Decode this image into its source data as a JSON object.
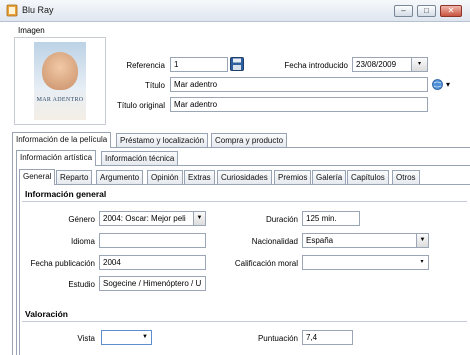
{
  "window": {
    "title": "Blu Ray",
    "minimize": "–",
    "maximize": "□",
    "close": "✕",
    "app_icon": "film-icon"
  },
  "image_section": {
    "label": "Imagen",
    "poster_title": "MAR ADENTRO"
  },
  "header_fields": {
    "referencia_label": "Referencia",
    "referencia_value": "1",
    "fecha_label": "Fecha introducido",
    "fecha_value": "23/08/2009",
    "titulo_label": "Título",
    "titulo_value": "Mar adentro",
    "titulo_original_label": "Título original",
    "titulo_original_value": "Mar adentro"
  },
  "main_tabs": [
    "Información de la película",
    "Préstamo y localización",
    "Compra y producto"
  ],
  "sub_tabs": [
    "Información artística",
    "Información técnica"
  ],
  "detail_tabs": [
    "General",
    "Reparto",
    "Argumento",
    "Opinión",
    "Extras",
    "Curiosidades",
    "Premios",
    "Galería",
    "Capítulos",
    "Otros"
  ],
  "general": {
    "section_title": "Información general",
    "genero_label": "Género",
    "genero_value": "2004: Oscar: Mejor peli",
    "duracion_label": "Duración",
    "duracion_value": "125 min.",
    "idioma_label": "Idioma",
    "idioma_value": "",
    "nacionalidad_label": "Nacionalidad",
    "nacionalidad_value": "España",
    "fecha_publicacion_label": "Fecha publicación",
    "fecha_publicacion_value": "2004",
    "calificacion_label": "Calificación moral",
    "calificacion_value": "",
    "estudio_label": "Estudio",
    "estudio_value": "Sogecine / Himenóptero / U"
  },
  "valoracion": {
    "section_title": "Valoración",
    "vista_label": "Vista",
    "vista_value": "",
    "puntuacion_label": "Puntuación",
    "puntuacion_value": "7,4"
  },
  "colors": {
    "accent": "#3a6ea5",
    "border": "#98a4b3",
    "titlebar": "#dfe6ef"
  }
}
